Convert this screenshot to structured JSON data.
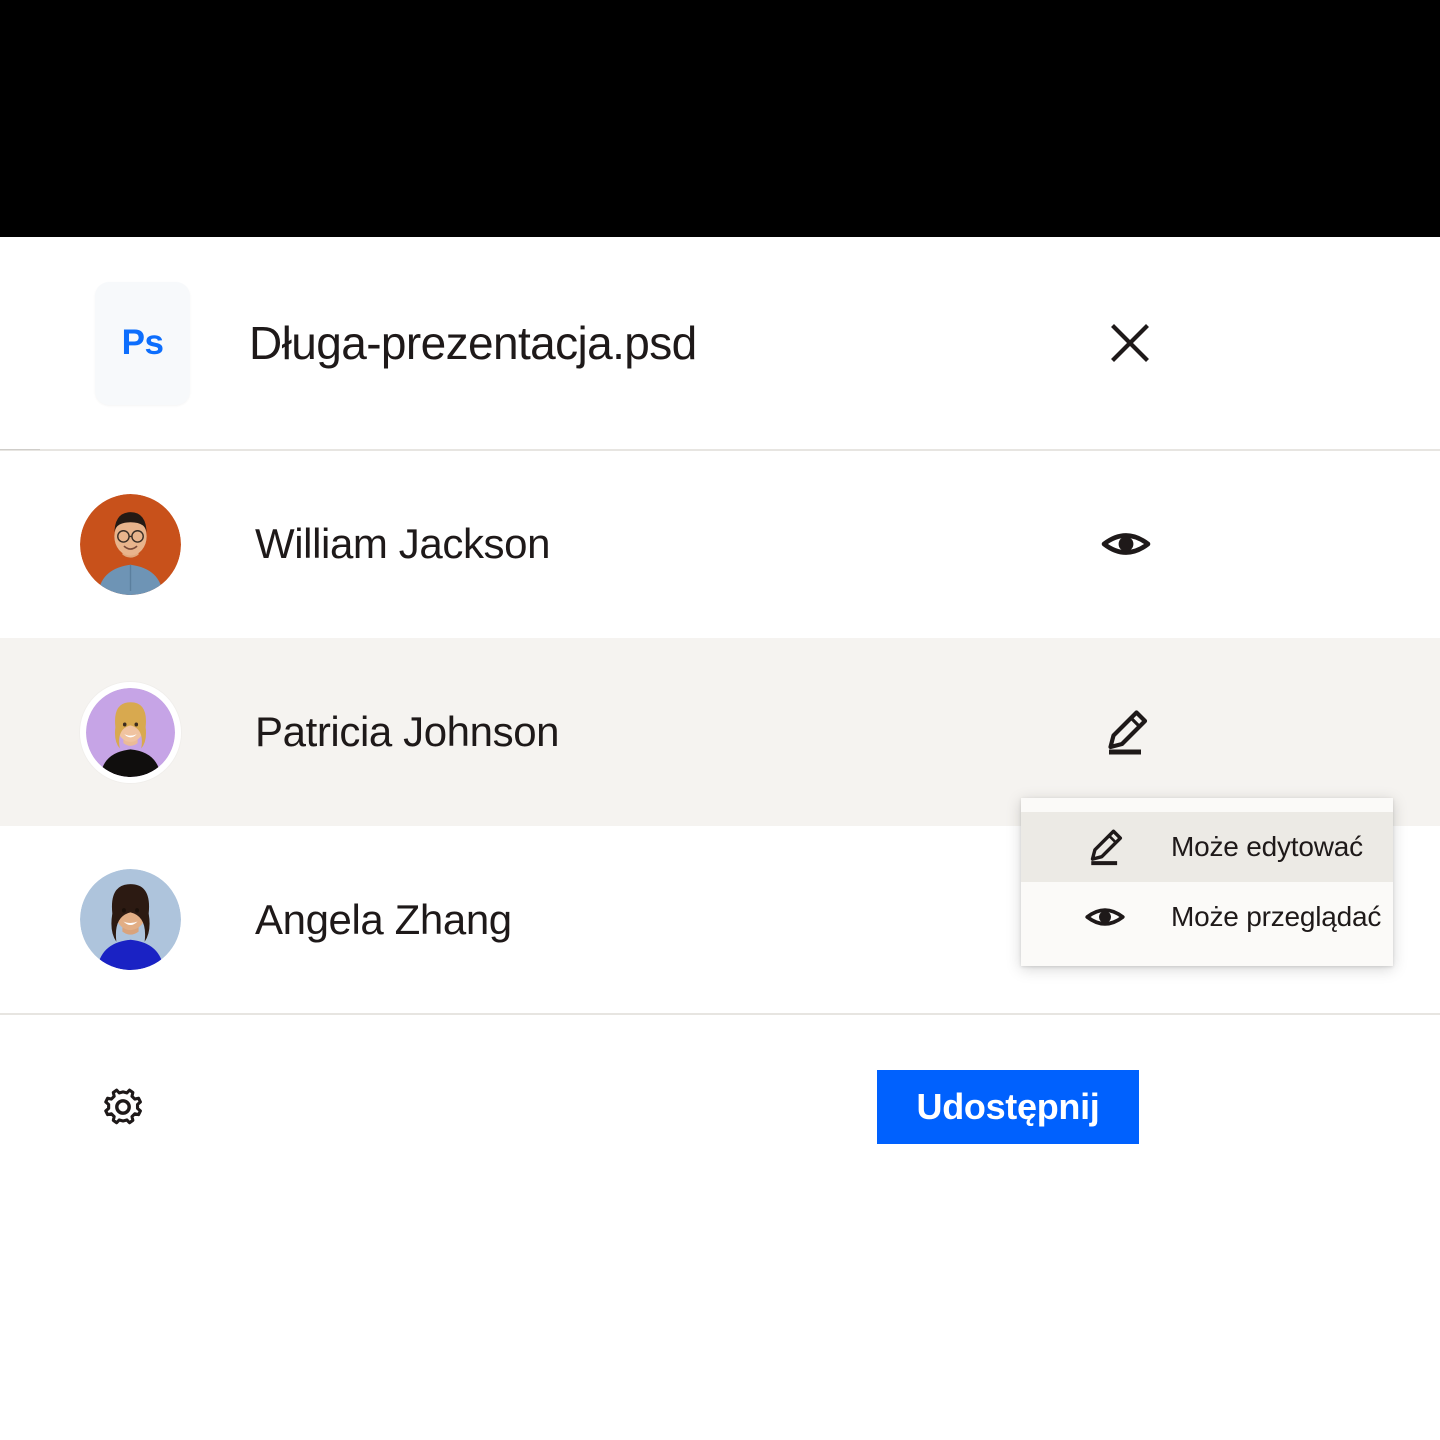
{
  "window": {
    "file_icon_label": "Ps",
    "file_name": "Długa-prezentacja.psd",
    "close_icon": "close-icon"
  },
  "people": [
    {
      "name": "William Jackson",
      "permission": "can-view",
      "permission_icon": "eye-icon",
      "avatar": {
        "background": "#C8511B",
        "shirt": "#6E94B5",
        "skin": "#E8B48C",
        "hair": "#241A14",
        "highlighted": false
      }
    },
    {
      "name": "Patricia Johnson",
      "permission": "can-edit",
      "permission_icon": "pencil-icon",
      "avatar": {
        "background": "#C6A4E6",
        "shirt": "#100E0D",
        "skin": "#F0C3A0",
        "hair": "#D8A94F",
        "highlighted": true
      }
    },
    {
      "name": "Angela Zhang",
      "permission": "can-edit",
      "permission_icon": "pencil-icon",
      "avatar": {
        "background": "#AEC4DC",
        "shirt": "#1A22C4",
        "skin": "#E2AE85",
        "hair": "#2C1A12",
        "highlighted": false
      }
    }
  ],
  "footer": {
    "settings_icon": "gear-icon",
    "share_label": "Udostępnij",
    "share_color": "#0061FE"
  },
  "dropdown": {
    "visible": true,
    "items": [
      {
        "label": "Może edytować",
        "icon": "pencil-icon",
        "active": true
      },
      {
        "label": "Może przeglądać",
        "icon": "eye-icon",
        "active": false
      }
    ]
  },
  "decor": {
    "top_band_color": "#000000",
    "barcode": "left-edge-barcode-strip",
    "noise_block": "right-grain-texture-block",
    "row_highlight_color": "#F5F3F0",
    "divider_color": "#E7E5E1"
  }
}
